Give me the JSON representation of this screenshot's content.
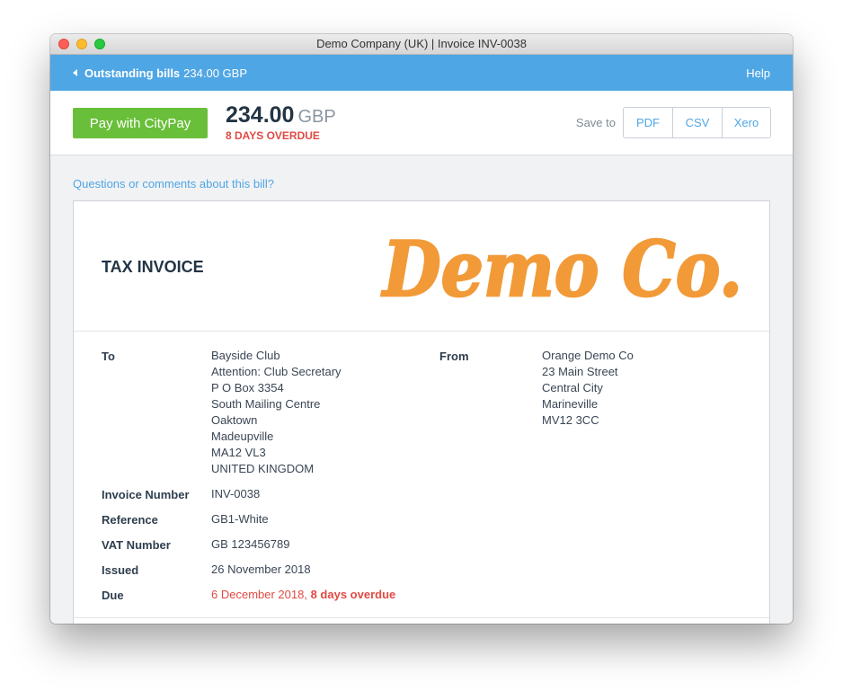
{
  "window": {
    "title": "Demo Company (UK) | Invoice INV-0038"
  },
  "topbar": {
    "back_label": "Outstanding bills",
    "back_amount": "234.00 GBP",
    "help": "Help"
  },
  "paybar": {
    "pay_button": "Pay with CityPay",
    "amount": "234.00",
    "currency": "GBP",
    "overdue": "8 DAYS OVERDUE",
    "save_to": "Save to",
    "save_options": [
      "PDF",
      "CSV",
      "Xero"
    ]
  },
  "questions_link": "Questions or comments about this bill?",
  "invoice": {
    "heading": "TAX INVOICE",
    "logo_text": "Demo Co.",
    "to_label": "To",
    "to_address": [
      "Bayside Club",
      "Attention: Club Secretary",
      "P O Box 3354",
      "South Mailing Centre",
      "Oaktown",
      "Madeupville",
      "MA12 VL3",
      "UNITED KINGDOM"
    ],
    "from_label": "From",
    "from_address": [
      "Orange Demo Co",
      "23 Main Street",
      "Central City",
      "Marineville",
      "MV12 3CC"
    ],
    "fields": [
      {
        "label": "Invoice Number",
        "value": "INV-0038"
      },
      {
        "label": "Reference",
        "value": "GB1-White"
      },
      {
        "label": "VAT Number",
        "value": "GB 123456789"
      },
      {
        "label": "Issued",
        "value": "26 November 2018"
      }
    ],
    "due_label": "Due",
    "due_date": "6 December 2018,",
    "due_overdue": "8 days overdue"
  },
  "colors": {
    "accent": "#4fa6e4",
    "pay_green": "#6abf3a",
    "overdue_red": "#e04a44",
    "logo_orange": "#f29a38"
  }
}
